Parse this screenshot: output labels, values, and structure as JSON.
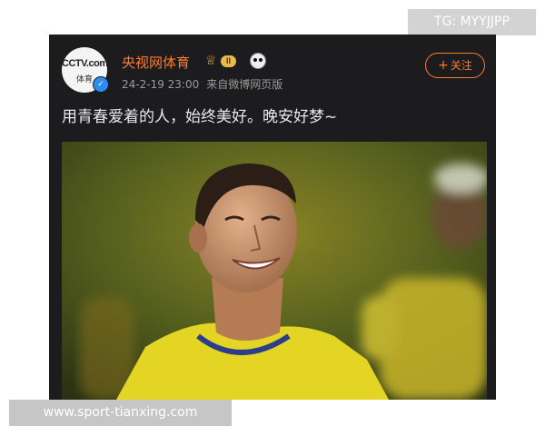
{
  "watermarks": {
    "top": "TG: MYYJJPP",
    "bottom": "www.sport-tianxing.com"
  },
  "post": {
    "avatar": {
      "logo": "CCTV.com",
      "logo_sub": "体育",
      "verified_icon": "verified-check-icon",
      "verified_glyph": "✓"
    },
    "username": "央视网体育",
    "badges": {
      "crown_icon": "crown-icon",
      "level": "II",
      "panda_icon": "panda-icon"
    },
    "timestamp": "24-2-19 23:00",
    "source": "来自微博网页版",
    "follow_button": {
      "plus": "+",
      "label": "关注"
    },
    "text": "用青春爱着的人，始终美好。晚安好梦~",
    "image": {
      "alt": "smiling-football-player-photo"
    }
  },
  "colors": {
    "card_background": "#1c1c1e",
    "username": "#ff7b2c",
    "follow_accent": "#ff7b2c",
    "meta_text": "#9a9a9a",
    "post_text": "#e8e8e8",
    "jersey_yellow": "#e8d82a",
    "verified_blue": "#2d8cf0"
  }
}
